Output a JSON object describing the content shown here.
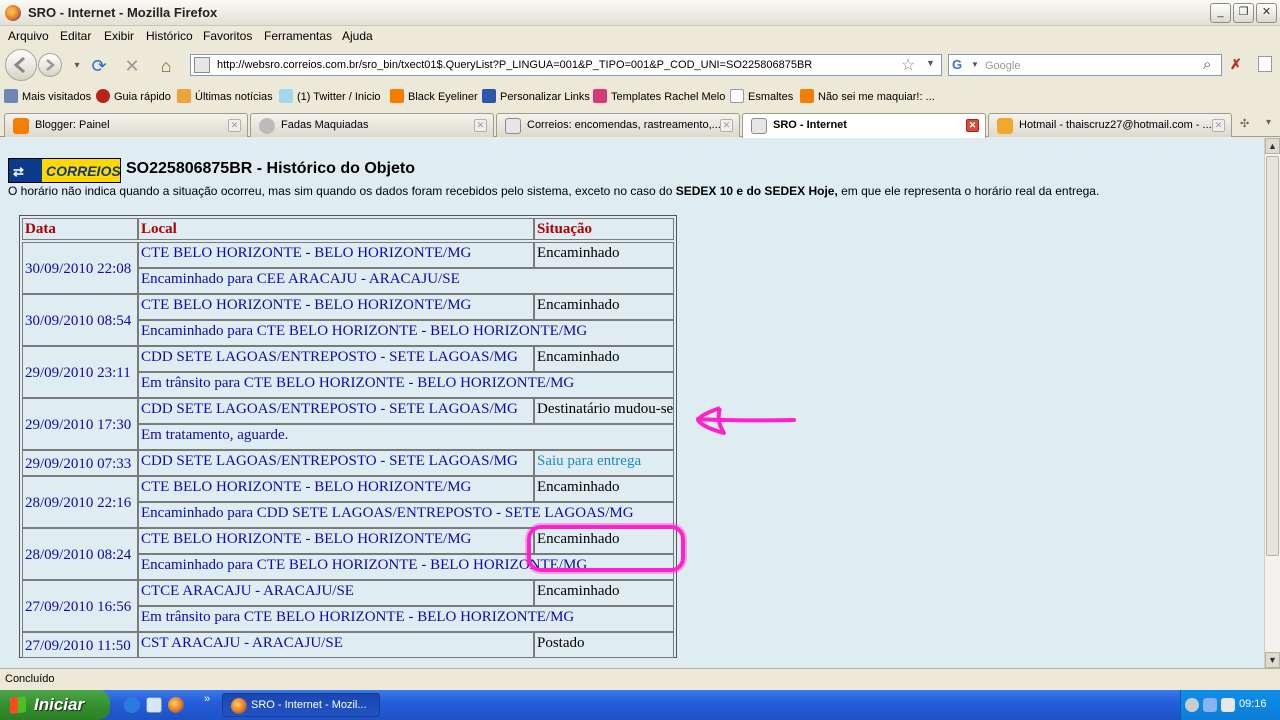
{
  "window": {
    "title": "SRO - Internet - Mozilla Firefox"
  },
  "menu": [
    "Arquivo",
    "Editar",
    "Exibir",
    "Histórico",
    "Favoritos",
    "Ferramentas",
    "Ajuda"
  ],
  "address": {
    "url": "http://websro.correios.com.br/sro_bin/txect01$.QueryList?P_LINGUA=001&P_TIPO=001&P_COD_UNI=SO225806875BR"
  },
  "search": {
    "placeholder": "Google"
  },
  "bookmarks": [
    "Mais visitados",
    "Guia rápido",
    "Últimas notícias",
    "(1) Twitter / Inicio",
    "Black Eyeliner",
    "Personalizar Links",
    "Templates Rachel Melo",
    "Esmaltes",
    "Não sei me maquiar!: ..."
  ],
  "tabs": [
    {
      "label": "Blogger: Painel"
    },
    {
      "label": "Fadas Maquiadas"
    },
    {
      "label": "Correios: encomendas, rastreamento,..."
    },
    {
      "label": "SRO - Internet"
    },
    {
      "label": "Hotmail - thaiscruz27@hotmail.com - ..."
    }
  ],
  "page": {
    "logo_text": "CORREIOS",
    "title": "SO225806875BR - Histórico do Objeto",
    "note_start": "O horário não indica quando a situação ocorreu, mas sim quando os dados foram recebidos pelo sistema, exceto no caso do ",
    "note_bold": "SEDEX 10 e do SEDEX Hoje,",
    "note_end": " em que ele representa o horário real da entrega."
  },
  "table": {
    "headers": {
      "date": "Data",
      "local": "Local",
      "status": "Situação"
    },
    "rows": [
      {
        "date": "30/09/2010 22:08",
        "local": "CTE BELO HORIZONTE - BELO HORIZONTE/MG",
        "status": "Encaminhado",
        "detail": "Encaminhado para CEE ARACAJU - ARACAJU/SE"
      },
      {
        "date": "30/09/2010 08:54",
        "local": "CTE BELO HORIZONTE - BELO HORIZONTE/MG",
        "status": "Encaminhado",
        "detail": "Encaminhado para CTE BELO HORIZONTE - BELO HORIZONTE/MG"
      },
      {
        "date": "29/09/2010 23:11",
        "local": "CDD SETE LAGOAS/ENTREPOSTO - SETE LAGOAS/MG",
        "status": "Encaminhado",
        "detail": "Em trânsito para CTE BELO HORIZONTE - BELO HORIZONTE/MG"
      },
      {
        "date": "29/09/2010 17:30",
        "local": "CDD SETE LAGOAS/ENTREPOSTO - SETE LAGOAS/MG",
        "status": "Destinatário mudou-se",
        "detail": "Em tratamento, aguarde."
      },
      {
        "date": "29/09/2010 07:33",
        "local": "CDD SETE LAGOAS/ENTREPOSTO - SETE LAGOAS/MG",
        "status": "Saiu para entrega",
        "detail": ""
      },
      {
        "date": "28/09/2010 22:16",
        "local": "CTE BELO HORIZONTE - BELO HORIZONTE/MG",
        "status": "Encaminhado",
        "detail": "Encaminhado para CDD SETE LAGOAS/ENTREPOSTO - SETE LAGOAS/MG"
      },
      {
        "date": "28/09/2010 08:24",
        "local": "CTE BELO HORIZONTE - BELO HORIZONTE/MG",
        "status": "Encaminhado",
        "detail": "Encaminhado para CTE BELO HORIZONTE - BELO HORIZONTE/MG"
      },
      {
        "date": "27/09/2010 16:56",
        "local": "CTCE ARACAJU - ARACAJU/SE",
        "status": "Encaminhado",
        "detail": "Em trânsito para CTE BELO HORIZONTE - BELO HORIZONTE/MG"
      },
      {
        "date": "27/09/2010 11:50",
        "local": "CST ARACAJU - ARACAJU/SE",
        "status": "Postado",
        "detail": ""
      }
    ]
  },
  "status_bar": {
    "text": "Concluído"
  },
  "taskbar": {
    "start_label": "Iniciar",
    "task_label": "SRO - Internet - Mozil...",
    "clock": "09:16"
  }
}
